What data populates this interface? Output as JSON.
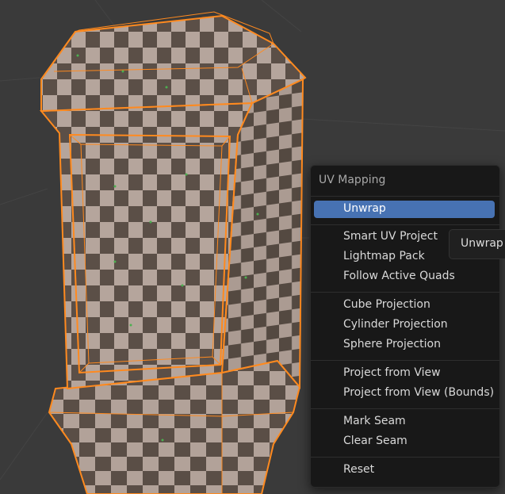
{
  "viewport": {
    "background": "#3a3a3a",
    "mesh_selection_color": "#ff8a1f"
  },
  "uv_menu": {
    "title": "UV Mapping",
    "items": [
      {
        "label": "Unwrap",
        "active": true
      },
      {
        "label": "Smart UV Project"
      },
      {
        "label": "Lightmap Pack"
      },
      {
        "label": "Follow Active Quads"
      },
      {
        "label": "Cube Projection"
      },
      {
        "label": "Cylinder Projection"
      },
      {
        "label": "Sphere Projection"
      },
      {
        "label": "Project from View"
      },
      {
        "label": "Project from View (Bounds)"
      },
      {
        "label": "Mark Seam"
      },
      {
        "label": "Clear Seam"
      },
      {
        "label": "Reset"
      }
    ],
    "highlight_color": "#4772b3"
  },
  "tooltip": {
    "text": "Unwrap t"
  }
}
